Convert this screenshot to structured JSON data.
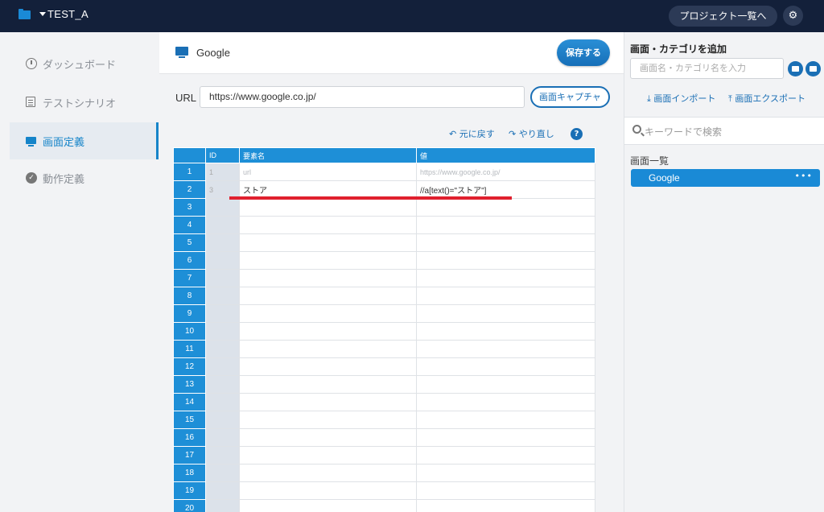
{
  "topbar": {
    "project_name": "TEST_A",
    "project_list_label": "プロジェクト一覧へ",
    "settings_icon": "gear-icon"
  },
  "sidebar": {
    "items": [
      {
        "label": "ダッシュボード",
        "icon": "clock-icon"
      },
      {
        "label": "テストシナリオ",
        "icon": "docs-icon"
      },
      {
        "label": "画面定義",
        "icon": "monitor-icon",
        "active": true
      },
      {
        "label": "動作定義",
        "icon": "check-circle-icon"
      }
    ]
  },
  "header": {
    "screen_title": "Google",
    "save_label": "保存する"
  },
  "url_bar": {
    "label": "URL",
    "value": "https://www.google.co.jp/",
    "capture_label": "画面キャプチャ"
  },
  "toolbar": {
    "undo_label": "元に戻す",
    "redo_label": "やり直し",
    "help_label": "?"
  },
  "table": {
    "headers": [
      "ID",
      "要素名",
      "値"
    ],
    "rows": [
      {
        "num": "1",
        "id": "1",
        "name": "url",
        "value": "https://www.google.co.jp/"
      },
      {
        "num": "2",
        "id": "3",
        "name": "ストア",
        "value": "//a[text()=\"ストア\"]"
      },
      {
        "num": "3",
        "id": "",
        "name": "",
        "value": ""
      },
      {
        "num": "4",
        "id": "",
        "name": "",
        "value": ""
      },
      {
        "num": "5",
        "id": "",
        "name": "",
        "value": ""
      },
      {
        "num": "6",
        "id": "",
        "name": "",
        "value": ""
      },
      {
        "num": "7",
        "id": "",
        "name": "",
        "value": ""
      },
      {
        "num": "8",
        "id": "",
        "name": "",
        "value": ""
      },
      {
        "num": "9",
        "id": "",
        "name": "",
        "value": ""
      },
      {
        "num": "10",
        "id": "",
        "name": "",
        "value": ""
      },
      {
        "num": "11",
        "id": "",
        "name": "",
        "value": ""
      },
      {
        "num": "12",
        "id": "",
        "name": "",
        "value": ""
      },
      {
        "num": "13",
        "id": "",
        "name": "",
        "value": ""
      },
      {
        "num": "14",
        "id": "",
        "name": "",
        "value": ""
      },
      {
        "num": "15",
        "id": "",
        "name": "",
        "value": ""
      },
      {
        "num": "16",
        "id": "",
        "name": "",
        "value": ""
      },
      {
        "num": "17",
        "id": "",
        "name": "",
        "value": ""
      },
      {
        "num": "18",
        "id": "",
        "name": "",
        "value": ""
      },
      {
        "num": "19",
        "id": "",
        "name": "",
        "value": ""
      },
      {
        "num": "20",
        "id": "",
        "name": "",
        "value": ""
      }
    ]
  },
  "right_panel": {
    "add_title": "画面・カテゴリを追加",
    "add_placeholder": "画面名・カテゴリ名を入力",
    "import_label": "画面インポート",
    "export_label": "画面エクスポート",
    "search_placeholder": "キーワードで検索",
    "list_title": "画面一覧",
    "screens": [
      {
        "label": "Google",
        "selected": true
      }
    ]
  },
  "colors": {
    "topbar": "#13203a",
    "accent": "#1a8ad6",
    "primary_button": "#1a6fb5",
    "annotation_red": "#e0202e"
  }
}
